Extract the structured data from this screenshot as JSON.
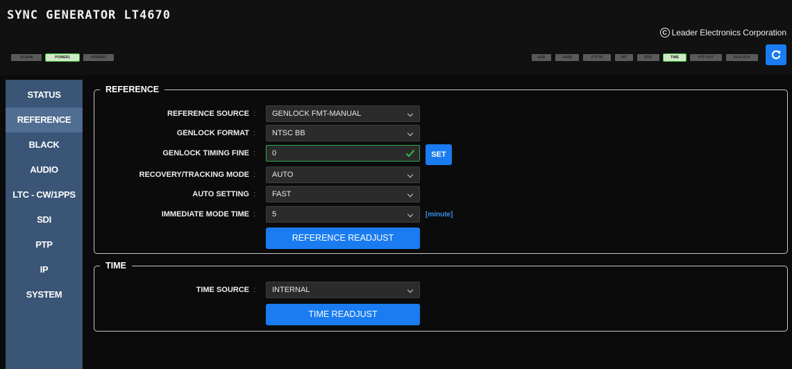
{
  "header": {
    "title": "SYNC GENERATOR  LT4670",
    "brand": "Leader Electronics Corporation",
    "brand_symbol": "C",
    "left_indicators": [
      {
        "label": "ALARM",
        "active": false
      },
      {
        "label": "POWER1",
        "active": true
      },
      {
        "label": "POWER2",
        "active": false
      }
    ],
    "right_indicators": [
      {
        "label": "GEN",
        "active": false
      },
      {
        "label": "GNSS",
        "active": false
      },
      {
        "label": "PTP IN",
        "active": false
      },
      {
        "label": "INT",
        "active": false
      },
      {
        "label": "STAT",
        "active": false
      },
      {
        "label": "TIME",
        "active": true
      },
      {
        "label": "PTP OUT",
        "active": false
      },
      {
        "label": "KEYLOCK",
        "active": false
      }
    ],
    "refresh_icon": "refresh-icon",
    "accent_color": "#1a7cf0"
  },
  "sidebar": {
    "items": [
      {
        "label": "STATUS",
        "active": false
      },
      {
        "label": "REFERENCE",
        "active": true
      },
      {
        "label": "BLACK",
        "active": false
      },
      {
        "label": "AUDIO",
        "active": false
      },
      {
        "label": "LTC - CW/1PPS",
        "active": false
      },
      {
        "label": "SDI",
        "active": false
      },
      {
        "label": "PTP",
        "active": false
      },
      {
        "label": "IP",
        "active": false
      },
      {
        "label": "SYSTEM",
        "active": false
      }
    ]
  },
  "reference": {
    "legend": "REFERENCE",
    "reference_source": {
      "label": "REFERENCE SOURCE",
      "value": "GENLOCK FMT-MANUAL"
    },
    "genlock_format": {
      "label": "GENLOCK FORMAT",
      "value": "NTSC BB"
    },
    "genlock_timing_fine": {
      "label": "GENLOCK TIMING FINE",
      "value": "0",
      "set_label": "SET"
    },
    "recovery_tracking_mode": {
      "label": "RECOVERY/TRACKING MODE",
      "value": "AUTO"
    },
    "auto_setting": {
      "label": "AUTO SETTING",
      "value": "FAST"
    },
    "immediate_mode_time": {
      "label": "IMMEDIATE MODE TIME",
      "value": "5",
      "unit": "[minute]"
    },
    "readjust_label": "REFERENCE READJUST"
  },
  "time": {
    "legend": "TIME",
    "time_source": {
      "label": "TIME SOURCE",
      "value": "INTERNAL"
    },
    "readjust_label": "TIME READJUST"
  },
  "colon": ":"
}
